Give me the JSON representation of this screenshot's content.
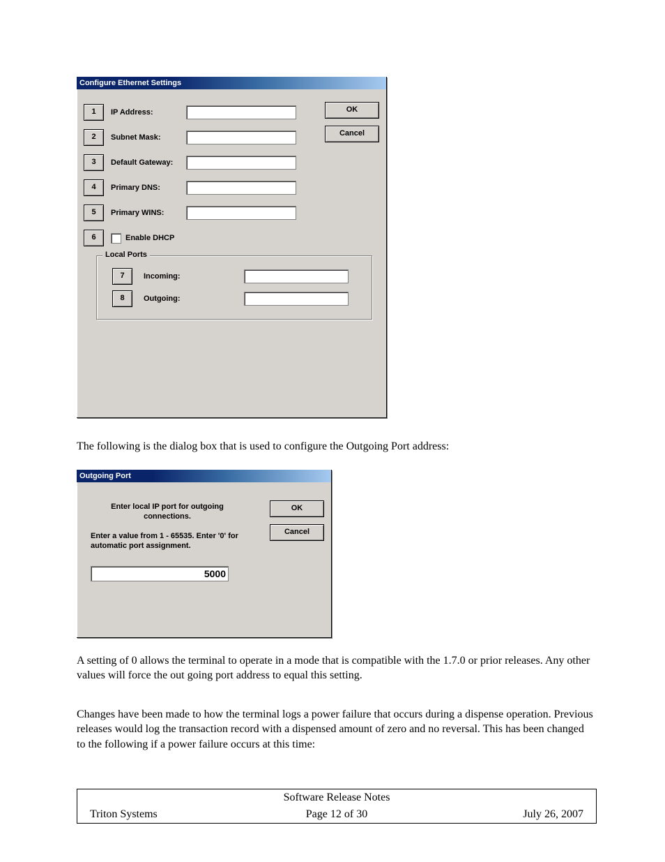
{
  "dialog1": {
    "title": "Configure Ethernet Settings",
    "ok": "OK",
    "cancel": "Cancel",
    "rows": [
      {
        "n": "1",
        "label": "IP Address:"
      },
      {
        "n": "2",
        "label": "Subnet Mask:"
      },
      {
        "n": "3",
        "label": "Default Gateway:"
      },
      {
        "n": "4",
        "label": "Primary DNS:"
      },
      {
        "n": "5",
        "label": "Primary WINS:"
      }
    ],
    "row6": {
      "n": "6",
      "label": "Enable DHCP"
    },
    "group": {
      "title": "Local Ports",
      "row7": {
        "n": "7",
        "label": "Incoming:"
      },
      "row8": {
        "n": "8",
        "label": "Outgoing:"
      }
    }
  },
  "para1": "The following is the dialog box that is used to configure the Outgoing Port address:",
  "dialog2": {
    "title": "Outgoing Port",
    "ok": "OK",
    "cancel": "Cancel",
    "prompt1": "Enter local IP port for outgoing connections.",
    "prompt2": "Enter a value from 1 - 65535. Enter '0' for automatic port assignment.",
    "value": "5000"
  },
  "para2": "A setting of 0 allows the terminal to operate in a mode that is compatible with the 1.7.0 or prior releases.  Any other values will force the out going port address to equal this setting.",
  "para3": "Changes have been made to how the terminal logs a power failure that occurs during a dispense operation.  Previous releases would log the transaction record with a dispensed amount of zero and no reversal.  This has been changed to the following if a power failure occurs at this time:",
  "footer": {
    "title": "Software Release Notes",
    "left": "Triton Systems",
    "mid": "Page 12 of 30",
    "right": "July 26, 2007"
  }
}
